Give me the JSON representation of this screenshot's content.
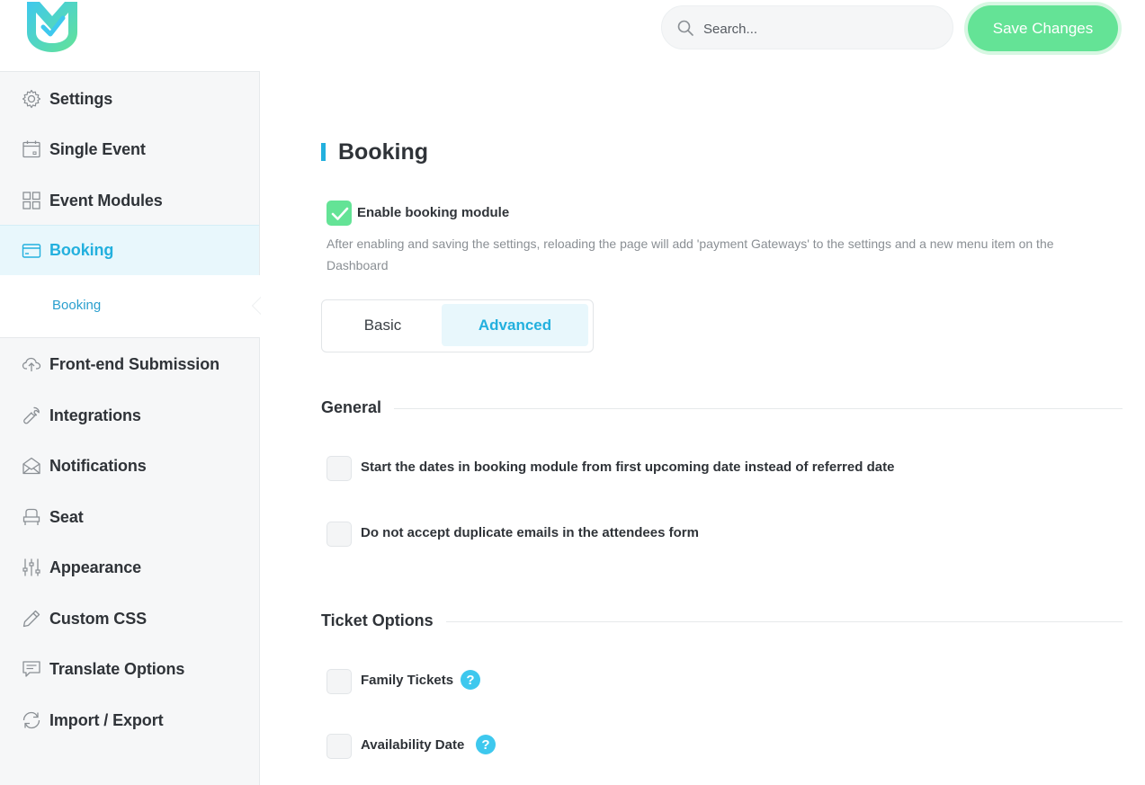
{
  "header": {
    "search_placeholder": "Search...",
    "save_label": "Save Changes",
    "logo_icon": "mec-logo-icon"
  },
  "sidebar": {
    "items": [
      {
        "label": "Settings",
        "icon": "gear-icon"
      },
      {
        "label": "Single Event",
        "icon": "calendar-icon"
      },
      {
        "label": "Event Modules",
        "icon": "grid-icon"
      },
      {
        "label": "Booking",
        "icon": "credit-card-icon",
        "active": true
      },
      {
        "label": "Front-end Submission",
        "icon": "cloud-upload-icon"
      },
      {
        "label": "Integrations",
        "icon": "wrench-icon"
      },
      {
        "label": "Notifications",
        "icon": "envelope-icon"
      },
      {
        "label": "Seat",
        "icon": "seat-icon"
      },
      {
        "label": "Appearance",
        "icon": "sliders-icon"
      },
      {
        "label": "Custom CSS",
        "icon": "pencil-icon"
      },
      {
        "label": "Translate Options",
        "icon": "message-icon"
      },
      {
        "label": "Import / Export",
        "icon": "refresh-icon"
      }
    ],
    "subitems": [
      {
        "label": "Booking"
      }
    ]
  },
  "main": {
    "title": "Booking",
    "enable": {
      "label": "Enable booking module",
      "checked": true,
      "description": "After enabling and saving the settings, reloading the page will add 'payment Gateways' to the settings and a new menu item on the Dashboard"
    },
    "tabs": [
      {
        "label": "Basic",
        "active": false
      },
      {
        "label": "Advanced",
        "active": true
      }
    ],
    "general": {
      "heading": "General",
      "options": [
        {
          "label": "Start the dates in booking module from first upcoming date instead of referred date",
          "checked": false
        },
        {
          "label": "Do not accept duplicate emails in the attendees form",
          "checked": false
        }
      ]
    },
    "ticket_options": {
      "heading": "Ticket Options",
      "options": [
        {
          "label": "Family Tickets",
          "checked": false,
          "help": "?"
        },
        {
          "label": "Availability Date",
          "checked": false,
          "help": "?"
        }
      ]
    }
  },
  "colors": {
    "accent": "#23b0de",
    "save_button": "#64e396",
    "help_icon": "#3ec8ee"
  }
}
